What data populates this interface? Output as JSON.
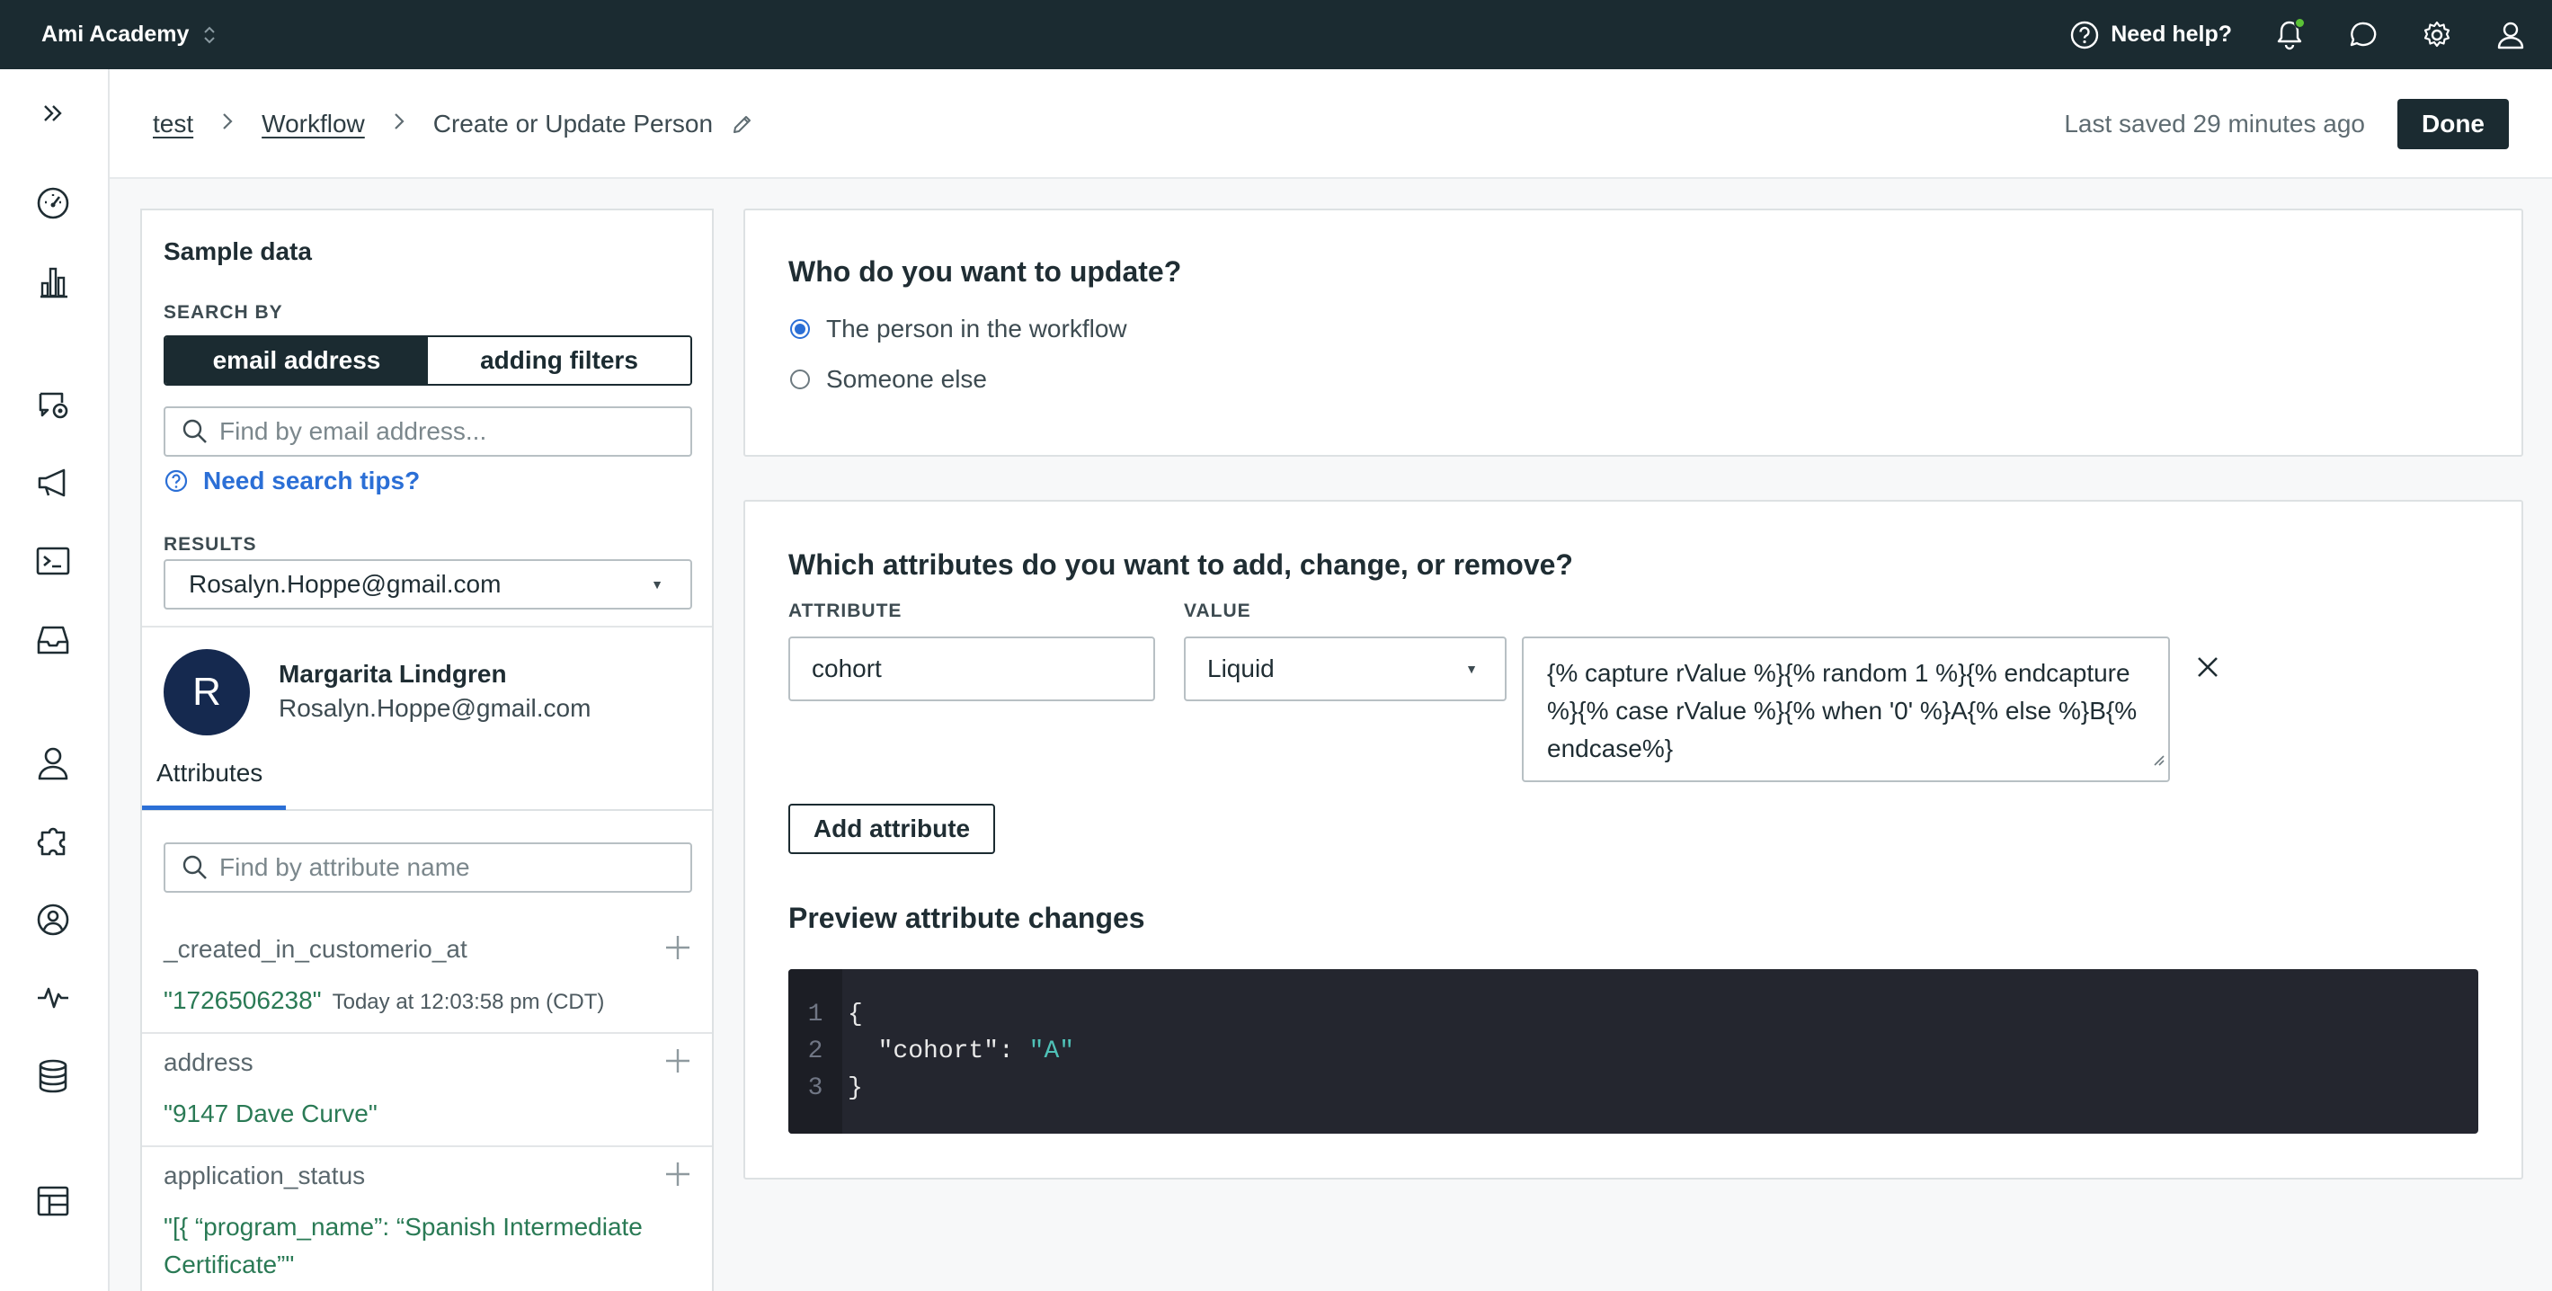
{
  "topbar": {
    "workspace": "Ami Academy",
    "help_label": "Need help?",
    "icons": [
      "help-circle-icon",
      "bell-icon",
      "chat-bubble-icon",
      "gear-icon",
      "user-icon"
    ],
    "notification_dot_color": "#5bc236"
  },
  "rail": {
    "items": [
      "expand-icon",
      "dashboard-gauge-icon",
      "bar-chart-icon",
      "campaign-icon",
      "megaphone-icon",
      "terminal-icon",
      "inbox-icon",
      "person-icon",
      "puzzle-icon",
      "user-circle-icon",
      "activity-icon",
      "database-icon",
      "table-icon"
    ]
  },
  "header": {
    "breadcrumbs": [
      "test",
      "Workflow"
    ],
    "current": "Create or Update Person",
    "saved": "Last saved 29 minutes ago",
    "done_label": "Done"
  },
  "sample": {
    "title": "Sample data",
    "search_by_label": "SEARCH BY",
    "seg_email": "email address",
    "seg_filters": "adding filters",
    "email_placeholder": "Find by email address...",
    "tips_label": "Need search tips?",
    "results_label": "RESULTS",
    "result_value": "Rosalyn.Hoppe@gmail.com",
    "person": {
      "initial": "R",
      "name": "Margarita Lindgren",
      "email": "Rosalyn.Hoppe@gmail.com"
    },
    "tab_label": "Attributes",
    "attr_placeholder": "Find by attribute name",
    "attributes": [
      {
        "name": "_created_in_customerio_at",
        "value": "\"1726506238\"",
        "meta": "Today at 12:03:58 pm (CDT)"
      },
      {
        "name": "address",
        "value": "\"9147 Dave Curve\"",
        "meta": ""
      },
      {
        "name": "application_status",
        "value": "\"[{ “program_name”: “Spanish Intermediate Certificate”\"",
        "meta": ""
      }
    ]
  },
  "who": {
    "title": "Who do you want to update?",
    "option1": "The person in the workflow",
    "option2": "Someone else",
    "selected": "The person in the workflow"
  },
  "attrs_card": {
    "title": "Which attributes do you want to add, change, or remove?",
    "attribute_label": "ATTRIBUTE",
    "value_label": "VALUE",
    "attribute_value": "cohort",
    "value_type": "Liquid",
    "liquid_value": "{% capture rValue %}{% random 1 %}{% endcapture %}{% case rValue %}{% when '0' %}A{% else %}B{% endcase%}",
    "add_label": "Add attribute",
    "preview_title": "Preview attribute changes",
    "code_lines": [
      {
        "n": "1",
        "text": "{"
      },
      {
        "n": "2",
        "key": "  \"cohort\": ",
        "str": "\"A\""
      },
      {
        "n": "3",
        "text": "}"
      }
    ]
  }
}
